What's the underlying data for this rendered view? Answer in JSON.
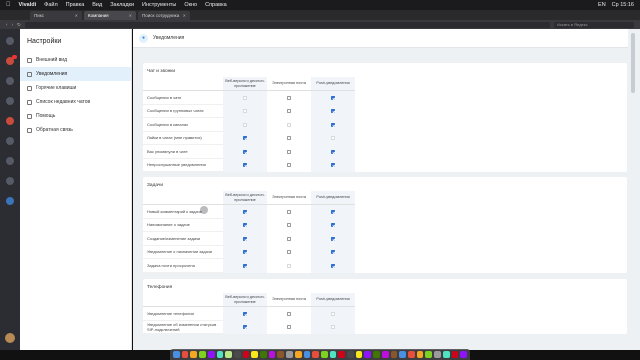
{
  "menubar": {
    "app": "Vivaldi",
    "items": [
      "Файл",
      "Правка",
      "Вид",
      "Закладки",
      "Инструменты",
      "Окно",
      "Справка"
    ],
    "right": [
      "EN",
      "Ср 15:16"
    ]
  },
  "tabs": [
    {
      "label": "Пикс",
      "active": false
    },
    {
      "label": "Компания",
      "active": true
    },
    {
      "label": "Поиск сотрудника",
      "active": false
    }
  ],
  "search_placeholder": "Искать в Яндекс",
  "settings": {
    "title": "Настройки",
    "items": [
      {
        "label": "Внешний вид",
        "active": false
      },
      {
        "label": "Уведомления",
        "active": true
      },
      {
        "label": "Горячие клавиши",
        "active": false
      },
      {
        "label": "Список недавних чатов",
        "active": false
      },
      {
        "label": "Помощь",
        "active": false
      },
      {
        "label": "Обратная связь",
        "active": false
      }
    ]
  },
  "header": {
    "title": "Уведомления"
  },
  "columns": [
    "Веб-версия и десктоп-приложение",
    "Электронная почта",
    "Push-уведомления"
  ],
  "sections": [
    {
      "title": "Чат и звонки",
      "rows": [
        {
          "label": "Сообщения в чате",
          "values": [
            "dis",
            "off",
            "on"
          ]
        },
        {
          "label": "Сообщения в групповых чатах",
          "values": [
            "dis",
            "off",
            "on"
          ]
        },
        {
          "label": "Сообщения в каналах",
          "values": [
            "dis",
            "dis",
            "on"
          ]
        },
        {
          "label": "Лайки в чатах (мне нравится)",
          "values": [
            "on",
            "off",
            "dis"
          ]
        },
        {
          "label": "Вас упомянули в чате",
          "values": [
            "on",
            "off",
            "on"
          ]
        },
        {
          "label": "Непрослушанные уведомления",
          "values": [
            "on",
            "off",
            "on"
          ]
        }
      ]
    },
    {
      "title": "Задачи",
      "rows": [
        {
          "label": "Новый комментарий к задаче",
          "values": [
            "on",
            "off",
            "on"
          ]
        },
        {
          "label": "Напоминание о задаче",
          "values": [
            "on",
            "off",
            "on"
          ]
        },
        {
          "label": "Создание/изменение задачи",
          "values": [
            "on",
            "off",
            "on"
          ]
        },
        {
          "label": "Уведомление о назначении задачи",
          "values": [
            "on",
            "off",
            "on"
          ]
        },
        {
          "label": "Задача почти просрочена",
          "values": [
            "on",
            "dis",
            "on"
          ]
        }
      ]
    },
    {
      "title": "Телефония",
      "rows": [
        {
          "label": "Уведомление телефонии",
          "values": [
            "on",
            "off",
            "dis"
          ]
        },
        {
          "label": "Уведомление об изменении статусов SIP-подключений",
          "values": [
            "on",
            "off",
            "dis"
          ]
        }
      ]
    }
  ]
}
